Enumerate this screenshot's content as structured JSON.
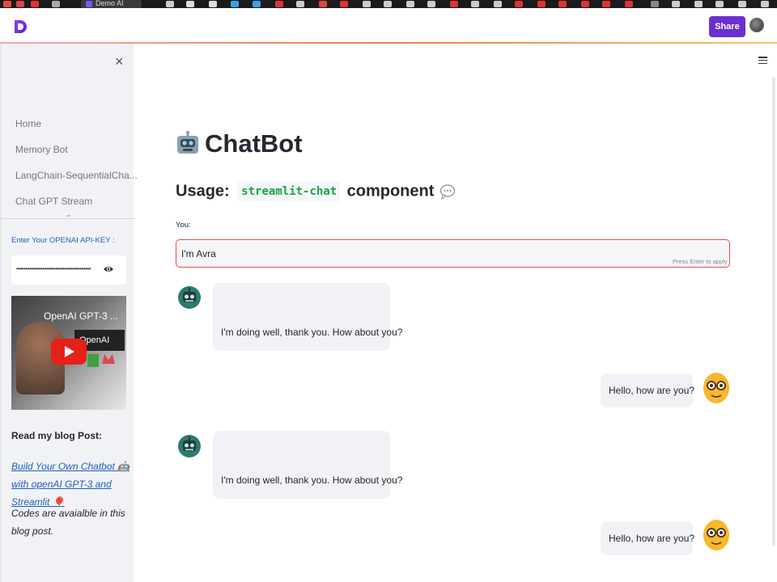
{
  "browser": {
    "active_tab_label": "Demo AI"
  },
  "header": {
    "share_label": "Share"
  },
  "sidebar": {
    "close_glyph": "×",
    "nav_items": [
      {
        "label": "Home"
      },
      {
        "label": "Memory Bot"
      },
      {
        "label": "LangChain-SequentialCha..."
      },
      {
        "label": "Chat GPT Stream"
      }
    ],
    "api_key_label": "Enter Your OPENAI API-KEY :",
    "api_key_mask": "••••••••••••••••••••••••••••••••••••••••",
    "video": {
      "title": "OpenAI GPT-3 ...",
      "brand": "OpenAI"
    },
    "blog_heading": "Read my blog Post:",
    "blog_link": "Build Your Own Chatbot 🤖 with openAI GPT-3 and Streamlit 🎈",
    "codes_note": "Codes are avaialble in this blog post."
  },
  "main": {
    "title": "ChatBot",
    "usage_prefix": "Usage:",
    "usage_code": "streamlit-chat",
    "usage_suffix": "component",
    "input_label": "You:",
    "input_value": "I'm Avra",
    "input_hint": "Press Enter to apply",
    "messages": [
      {
        "role": "bot",
        "text": "I'm doing well, thank you. How about you?"
      },
      {
        "role": "user",
        "text": "Hello, how are you?"
      },
      {
        "role": "bot",
        "text": "I'm doing well, thank you. How about you?"
      },
      {
        "role": "user",
        "text": "Hello, how are you?"
      }
    ]
  },
  "colors": {
    "accent": "#6b2fd0",
    "input_border": "#f04b4b",
    "code_text": "#17a34a",
    "link": "#1f5fbf",
    "sidebar_bg": "#f0f2f6",
    "bot_avatar": "#2c7a72",
    "user_avatar": "#f5b82e"
  },
  "icons": {
    "logo": "streamlit-logo-icon",
    "close": "close-icon",
    "menu": "hamburger-menu-icon",
    "eye": "eye-icon",
    "play": "youtube-play-icon",
    "bot": "robot-avatar-icon",
    "user": "nerd-face-avatar-icon",
    "speech": "speech-bubble-icon"
  }
}
